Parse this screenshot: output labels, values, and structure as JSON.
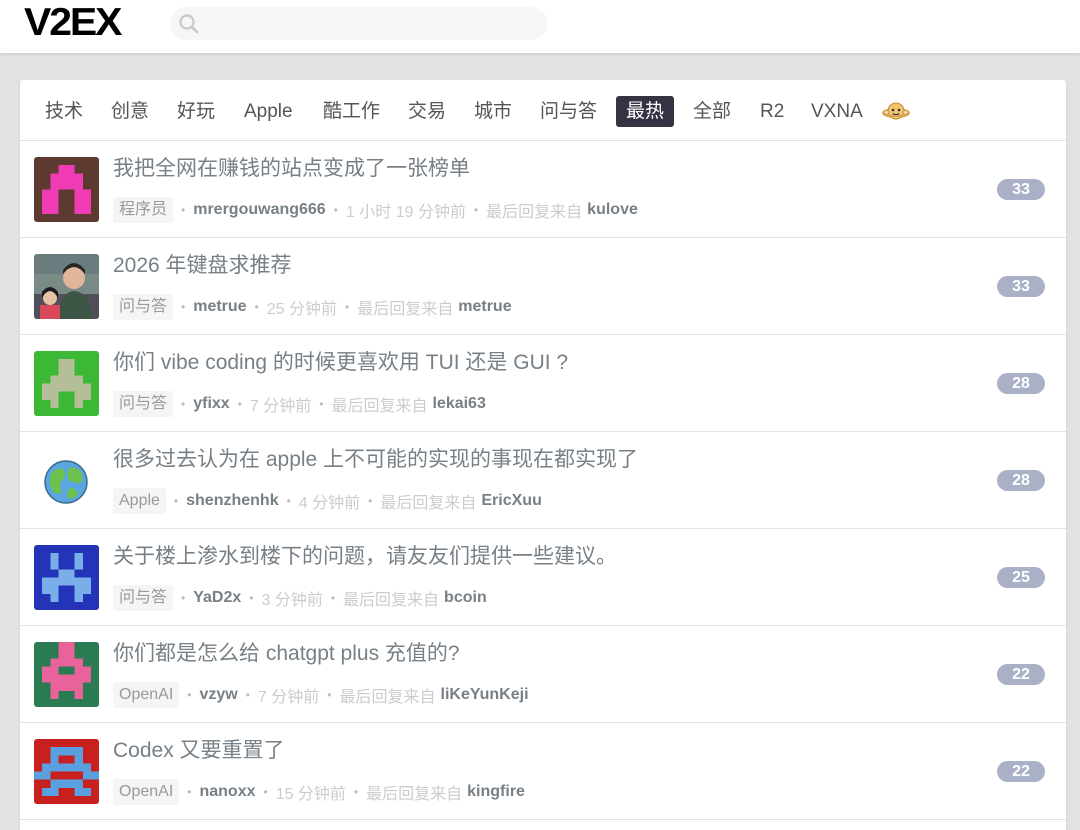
{
  "header": {
    "logo": "V2EX",
    "search_placeholder": ""
  },
  "colors": {
    "accent_tab": "#333344",
    "count_badge": "#aab0c6",
    "title_text": "#778087"
  },
  "tabs": [
    {
      "label": "技术"
    },
    {
      "label": "创意"
    },
    {
      "label": "好玩"
    },
    {
      "label": "Apple"
    },
    {
      "label": "酷工作"
    },
    {
      "label": "交易"
    },
    {
      "label": "城市"
    },
    {
      "label": "问与答"
    },
    {
      "label": "最热",
      "current": true
    },
    {
      "label": "全部"
    },
    {
      "label": "R2"
    },
    {
      "label": "VXNA"
    }
  ],
  "tab_extra_icon": "planet-icon",
  "topics": [
    {
      "title": "我把全网在赚钱的站点变成了一张榜单",
      "node": "程序员",
      "author": "mrergouwang666",
      "time": "1 小时 19 分钟前",
      "last_label": "最后回复来自",
      "last_user": "kulove",
      "replies": "33"
    },
    {
      "title": "2026 年键盘求推荐",
      "node": "问与答",
      "author": "metrue",
      "time": "25 分钟前",
      "last_label": "最后回复来自",
      "last_user": "metrue",
      "replies": "33"
    },
    {
      "title": "你们 vibe coding 的时候更喜欢用 TUI 还是 GUI ?",
      "node": "问与答",
      "author": "yfixx",
      "time": "7 分钟前",
      "last_label": "最后回复来自",
      "last_user": "lekai63",
      "replies": "28"
    },
    {
      "title": "很多过去认为在 apple 上不可能的实现的事现在都实现了",
      "node": "Apple",
      "author": "shenzhenhk",
      "time": "4 分钟前",
      "last_label": "最后回复来自",
      "last_user": "EricXuu",
      "replies": "28"
    },
    {
      "title": "关于楼上渗水到楼下的问题，请友友们提供一些建议。",
      "node": "问与答",
      "author": "YaD2x",
      "time": "3 分钟前",
      "last_label": "最后回复来自",
      "last_user": "bcoin",
      "replies": "25"
    },
    {
      "title": "你们都是怎么给 chatgpt plus 充值的?",
      "node": "OpenAI",
      "author": "vzyw",
      "time": "7 分钟前",
      "last_label": "最后回复来自",
      "last_user": "liKeYunKeji",
      "replies": "22"
    },
    {
      "title": "Codex 又要重置了",
      "node": "OpenAI",
      "author": "nanoxx",
      "time": "15 分钟前",
      "last_label": "最后回复来自",
      "last_user": "kingfire",
      "replies": "22"
    }
  ]
}
